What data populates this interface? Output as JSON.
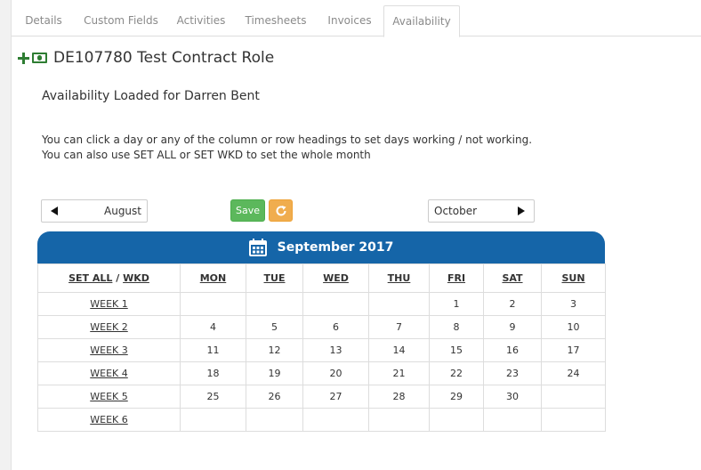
{
  "tabs": [
    "Details",
    "Custom Fields",
    "Activities",
    "Timesheets",
    "Invoices",
    "Availability"
  ],
  "active_tab": "Availability",
  "role": {
    "title": "DE107780 Test Contract Role"
  },
  "availability": {
    "loaded_message": "Availability Loaded for Darren Bent",
    "instruction_1": "You can click a day or any of the column or row headings to set days working / not working.",
    "instruction_2": "You can also use SET ALL or SET WKD to set the whole month"
  },
  "nav": {
    "prev_label": "August",
    "next_label": "October",
    "save_label": "Save"
  },
  "calendar": {
    "title": "September 2017",
    "set_all": "SET ALL",
    "separator": "/",
    "wkd": "WKD",
    "days": [
      "MON",
      "TUE",
      "WED",
      "THU",
      "FRI",
      "SAT",
      "SUN"
    ],
    "weeks": [
      {
        "label": "WEEK 1",
        "dates": [
          "",
          "",
          "",
          "",
          "1",
          "2",
          "3"
        ]
      },
      {
        "label": "WEEK 2",
        "dates": [
          "4",
          "5",
          "6",
          "7",
          "8",
          "9",
          "10"
        ]
      },
      {
        "label": "WEEK 3",
        "dates": [
          "11",
          "12",
          "13",
          "14",
          "15",
          "16",
          "17"
        ]
      },
      {
        "label": "WEEK 4",
        "dates": [
          "18",
          "19",
          "20",
          "21",
          "22",
          "23",
          "24"
        ]
      },
      {
        "label": "WEEK 5",
        "dates": [
          "25",
          "26",
          "27",
          "28",
          "29",
          "30",
          ""
        ]
      },
      {
        "label": "WEEK 6",
        "dates": [
          "",
          "",
          "",
          "",
          "",
          "",
          ""
        ]
      }
    ]
  },
  "colors": {
    "header_blue": "#1565a8",
    "save_green": "#5cb85c",
    "refresh_orange": "#f0ad4e",
    "icon_green": "#2e7d32"
  }
}
